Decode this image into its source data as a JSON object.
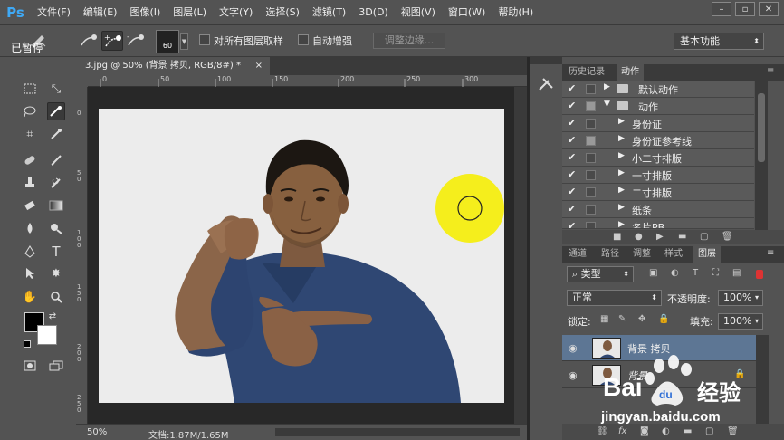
{
  "app": {
    "logo": "Ps"
  },
  "menu": [
    "文件(F)",
    "编辑(E)",
    "图像(I)",
    "图层(L)",
    "文字(Y)",
    "选择(S)",
    "滤镜(T)",
    "3D(D)",
    "视图(V)",
    "窗口(W)",
    "帮助(H)"
  ],
  "window_controls": {
    "minimize": "–",
    "restore": "▫",
    "close": "✕"
  },
  "options": {
    "paused_label": "已暂停",
    "brush_size": "60",
    "sample_all_layers": "对所有图层取样",
    "auto_enhance": "自动增强",
    "refine_edge": "调整边缘...",
    "workspace": "基本功能"
  },
  "document": {
    "tab_title": "3.jpg @ 50% (背景 拷贝, RGB/8#) *",
    "close": "×",
    "zoom": "50%",
    "doc_size": "文档:1.87M/1.65M"
  },
  "ruler": {
    "h_labels": [
      "0",
      "50",
      "100",
      "150",
      "200",
      "250",
      "300"
    ],
    "v_labels": [
      "0",
      "5 0",
      "1 0 0",
      "1 5 0",
      "2 0 0",
      "2 5 0",
      "3 0 0"
    ]
  },
  "actions_panel": {
    "tabs": [
      "历史记录",
      "动作"
    ],
    "active_tab": "动作",
    "rows": [
      {
        "checked": true,
        "box": false,
        "expanded": false,
        "folder": true,
        "label": "默认动作"
      },
      {
        "checked": true,
        "box": true,
        "expanded": true,
        "folder": true,
        "label": "动作"
      },
      {
        "checked": true,
        "box": false,
        "expanded": false,
        "folder": false,
        "label": "身份证"
      },
      {
        "checked": true,
        "box": true,
        "expanded": false,
        "folder": false,
        "label": "身份证参考线"
      },
      {
        "checked": true,
        "box": false,
        "expanded": false,
        "folder": false,
        "label": "小二寸排版"
      },
      {
        "checked": true,
        "box": false,
        "expanded": false,
        "folder": false,
        "label": "一寸排版"
      },
      {
        "checked": true,
        "box": false,
        "expanded": false,
        "folder": false,
        "label": "二寸排版"
      },
      {
        "checked": true,
        "box": false,
        "expanded": false,
        "folder": false,
        "label": "纸条"
      },
      {
        "checked": true,
        "box": false,
        "expanded": false,
        "folder": false,
        "label": "名片PB"
      }
    ]
  },
  "layers_panel": {
    "tabs": [
      "通道",
      "路径",
      "调整",
      "样式",
      "图层"
    ],
    "active_tab": "图层",
    "filter": "类型",
    "blend_mode": "正常",
    "opacity_label": "不透明度:",
    "opacity": "100%",
    "lock_label": "锁定:",
    "fill_label": "填充:",
    "fill": "100%",
    "layers": [
      {
        "name": "背景 拷贝",
        "selected": true,
        "locked": false
      },
      {
        "name": "背景",
        "selected": false,
        "locked": true
      }
    ]
  },
  "watermark": {
    "brand": "Bai",
    "brand_cn": "经验",
    "url": "jingyan.baidu.com"
  },
  "colors": {
    "ui_gray": "#535353",
    "dark": "#282828",
    "selected_layer": "#5d7694",
    "brush_cursor": "#f5ee1c",
    "photo_bg": "#ececec"
  }
}
